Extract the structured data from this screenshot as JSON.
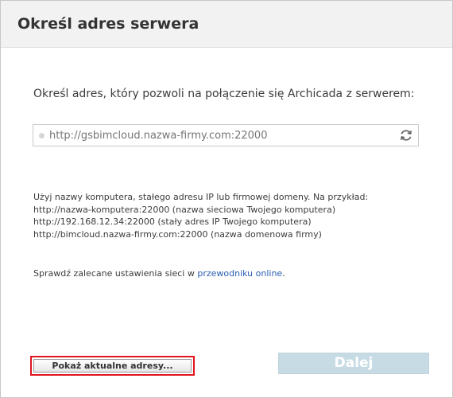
{
  "dialog": {
    "title": "Określ adres serwera",
    "prompt": "Określ adres, który pozwoli na połączenie się Archicada z serwerem:",
    "address": {
      "placeholder": "http://gsbimcloud.nazwa-firmy.com:22000",
      "value": ""
    },
    "hint_lines": [
      "Użyj nazwy komputera, stałego adresu IP lub firmowej domeny. Na przykład:",
      "http://nazwa-komputera:22000 (nazwa sieciowa Twojego komputera)",
      "http://192.168.12.34:22000 (stały adres IP Twojego komputera)",
      "http://bimcloud.nazwa-firmy.com:22000 (nazwa domenowa firmy)"
    ],
    "check": {
      "prefix": "Sprawdź zalecane ustawienia sieci w ",
      "link": "przewodniku online",
      "suffix": "."
    },
    "buttons": {
      "show_addresses": "Pokaż aktualne adresy...",
      "next": "Dalej"
    }
  },
  "icons": {
    "refresh": "refresh-icon",
    "status": "status-dot"
  },
  "colors": {
    "link": "#2a5db0",
    "highlight_border": "#e0141e",
    "next_disabled": "#c7dbe4"
  }
}
